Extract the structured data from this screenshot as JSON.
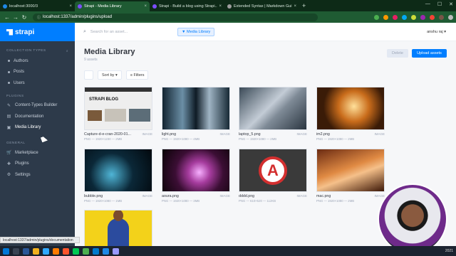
{
  "browser": {
    "tabs": [
      {
        "label": "localhost:3000/3",
        "color": "#1e88e5"
      },
      {
        "label": "Strapi - Media Library",
        "color": "#7c4dff"
      },
      {
        "label": "Strapi - Build a blog using Strapi...",
        "color": "#7c4dff"
      },
      {
        "label": "Extended Syntax | Markdown Gui...",
        "color": "#9e9e9e"
      }
    ],
    "url": "localhost:1337/admin/plugins/upload"
  },
  "sidebar": {
    "brand": "strapi",
    "collection_header": "COLLECTION TYPES",
    "collection_items": [
      "Authors",
      "Posts",
      "Users"
    ],
    "plugins_header": "PLUGINS",
    "plugin_items": [
      "Content-Types Builder",
      "Documentation",
      "Media Library"
    ],
    "general_header": "GENERAL",
    "general_items": [
      "Marketplace",
      "Plugins",
      "Settings"
    ]
  },
  "topbar": {
    "search_placeholder": "Search for an asset...",
    "plugin_tag": "Media Library",
    "user": "anshu raj"
  },
  "main": {
    "title": "Media Library",
    "subtitle": "9 assets",
    "delete_label": "Delete",
    "upload_label": "Upload assets",
    "sort_label": "Sort by",
    "filters_label": "Filters"
  },
  "assets": [
    {
      "name": "Capture-d-e-cran-2020-01...",
      "type": "IMAGE",
      "meta": "PNG — 1920×1230 — 2MB"
    },
    {
      "name": "light.png",
      "type": "IMAGE",
      "meta": "PNG — 1920×1080 — 4MB"
    },
    {
      "name": "laptop_5.png",
      "type": "IMAGE",
      "meta": "PNG — 1920×1080 — 2MB"
    },
    {
      "name": "im2.png",
      "type": "IMAGE",
      "meta": "PNG — 1920×1080 — 2MB"
    },
    {
      "name": "bubble.png",
      "type": "IMAGE",
      "meta": "PNG — 1920×1080 — 1MB"
    },
    {
      "name": "aoura.png",
      "type": "IMAGE",
      "meta": "PNG — 1920×1080 — 3MB"
    },
    {
      "name": "dddd.png",
      "type": "IMAGE",
      "meta": "PNG — 610×520 — 112KB"
    },
    {
      "name": "mac.png",
      "type": "IMAGE",
      "meta": "PNG — 1920×1080 — 2MB"
    },
    {
      "name": "",
      "type": "",
      "meta": ""
    }
  ],
  "thumb_text": {
    "blog_title": "STRAPI BLOG",
    "logo_letter": "A"
  },
  "status_url": "localhost:1337/admin/plugins/documentation",
  "taskbar_time": "2021"
}
